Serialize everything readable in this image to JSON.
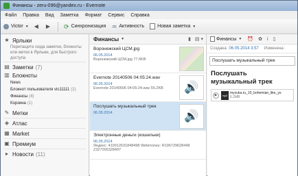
{
  "window": {
    "title": "Финансы - zeru-096@yandex.ru - Evernote"
  },
  "menubar": {
    "items": [
      "Файл",
      "Правка",
      "Вид",
      "Заметка",
      "Формат",
      "Сервис",
      "Справка"
    ]
  },
  "toolbar": {
    "user": "Victor",
    "sync_label": "Синхронизация",
    "activity_label": "Активность",
    "new_note_label": "Новая заметка"
  },
  "sidebar": {
    "shortcuts_label": "Ярлыки",
    "shortcuts_hint": "Перетащите сюда заметки, блокноты или метки в Ярлыки, для быстрого доступа",
    "notes_label": "Заметки",
    "notes_count": "(7)",
    "notebooks_label": "Блокноты",
    "notebooks": [
      {
        "label": "News",
        "count": ""
      },
      {
        "label": "Блокнот пользователя vic11111",
        "count": "(2)"
      },
      {
        "label": "Финансы",
        "count": "(4)"
      },
      {
        "label": "Корзина",
        "count": "(1)"
      }
    ],
    "tags_label": "Метки",
    "atlas_label": "Атлас",
    "market_label": "Market",
    "premium_label": "Премиум",
    "news_label": "Новости",
    "news_count": "(11)"
  },
  "notelist": {
    "notebook_name": "Финансы",
    "notes": [
      {
        "title": "Воронежский ЦСМ.jpg",
        "date": "06.05.2014",
        "snippet": "Воронежский ЦСМ.jpg  77.6KB",
        "thumb": "map"
      },
      {
        "title": "Evernote 20140506 04:05:24.wav",
        "date": "06.05.2014",
        "snippet": "Evernote 20140506 04:05:24.wav  55.2KB",
        "thumb": "audio"
      },
      {
        "title": "Послушать музыкальный трек",
        "date": "06.05.2014",
        "snippet": "",
        "thumb": "audio"
      },
      {
        "title": "Электронные деньги (кошельки)",
        "date": "06.05.2014",
        "snippet": "Яндекс: 410012631848498 Webmoney: R196729628448 Z327265328497",
        "thumb": "none"
      }
    ]
  },
  "notepane": {
    "notebook": "Финансы",
    "created_label": "Создана:",
    "created_date": "06.05.2014 3:57",
    "modified_label": "Изменена:",
    "title": "Послушать музыкальный трек",
    "heading": "Послушать музыкальный трек",
    "attachment_name": "myzuka.ru_10_bohemian_like_yo",
    "attachment_size": "6.2MB",
    "attachment_badge": "mp3"
  }
}
